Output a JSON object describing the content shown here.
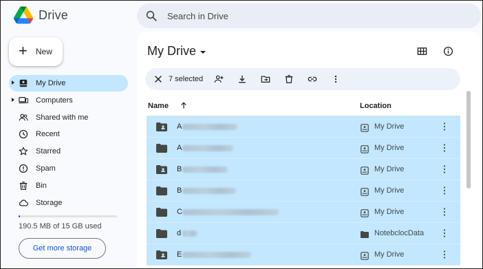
{
  "app": {
    "name": "Drive"
  },
  "search": {
    "placeholder": "Search in Drive"
  },
  "new_button": {
    "label": "New"
  },
  "sidebar": {
    "items": [
      {
        "label": "My Drive",
        "icon": "my-drive-icon",
        "active": true,
        "expandable": true
      },
      {
        "label": "Computers",
        "icon": "computers-icon",
        "active": false,
        "expandable": true
      },
      {
        "label": "Shared with me",
        "icon": "shared-icon",
        "active": false,
        "expandable": false
      },
      {
        "label": "Recent",
        "icon": "clock-icon",
        "active": false,
        "expandable": false
      },
      {
        "label": "Starred",
        "icon": "star-icon",
        "active": false,
        "expandable": false
      },
      {
        "label": "Spam",
        "icon": "spam-icon",
        "active": false,
        "expandable": false
      },
      {
        "label": "Bin",
        "icon": "bin-icon",
        "active": false,
        "expandable": false
      },
      {
        "label": "Storage",
        "icon": "cloud-icon",
        "active": false,
        "expandable": false
      }
    ],
    "storage_used_fraction": 0.013,
    "storage_text": "190.5 MB of 15 GB used",
    "get_storage_label": "Get more storage"
  },
  "main": {
    "title": "My Drive",
    "selection": {
      "count_label": "7 selected"
    },
    "columns": {
      "name": "Name",
      "location": "Location"
    },
    "rows": [
      {
        "first_letter": "A",
        "shared": true,
        "location": "My Drive"
      },
      {
        "first_letter": "A",
        "shared": false,
        "location": "My Drive"
      },
      {
        "first_letter": "B",
        "shared": true,
        "location": "My Drive"
      },
      {
        "first_letter": "B",
        "shared": false,
        "location": "My Drive"
      },
      {
        "first_letter": "C",
        "shared": false,
        "location": "My Drive"
      },
      {
        "first_letter": "d",
        "shared": false,
        "location": "NotebclocData"
      },
      {
        "first_letter": "E",
        "shared": true,
        "location": "My Drive"
      }
    ]
  },
  "colors": {
    "accent": "#0b57d0",
    "selection": "#c2e7ff",
    "sidebar_bg": "#f8fafd",
    "action_bar_bg": "#edf2fa"
  }
}
